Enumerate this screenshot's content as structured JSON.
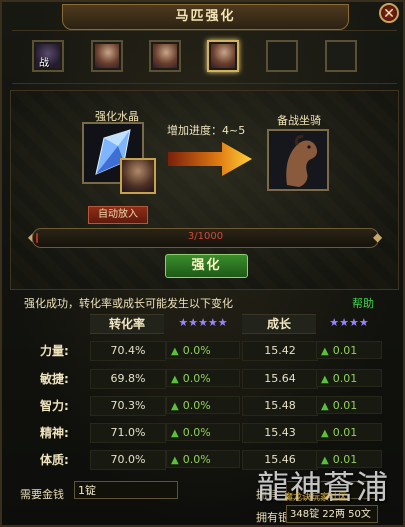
{
  "window": {
    "title": "马匹强化",
    "close_icon": "close-icon"
  },
  "slots": [
    {
      "tag": "战",
      "selected": false
    },
    {
      "tag": "",
      "selected": false
    },
    {
      "tag": "",
      "selected": false
    },
    {
      "tag": "",
      "selected": true
    },
    {
      "tag": "",
      "selected": false
    },
    {
      "tag": "",
      "selected": false
    }
  ],
  "enhance": {
    "crystal_label": "强化水晶",
    "auto_button": "自动放入",
    "progress_label": "增加进度：4~5",
    "target_label": "备战坐骑",
    "progress_text": "3/1000",
    "progress_fraction": 0.003,
    "strengthen_button": "强化"
  },
  "notice": "强化成功，转化率或成长可能发生以下变化",
  "help": "帮助",
  "table": {
    "headers": {
      "conversion": "转化率",
      "growth": "成长",
      "stars5": "★★★★★",
      "stars4": "★★★★"
    },
    "rows": [
      {
        "label": "力量:",
        "conv": "70.4%",
        "conv_up": "0.0%",
        "growth": "15.42",
        "growth_up": "0.01"
      },
      {
        "label": "敏捷:",
        "conv": "69.8%",
        "conv_up": "0.0%",
        "growth": "15.64",
        "growth_up": "0.01"
      },
      {
        "label": "智力:",
        "conv": "70.3%",
        "conv_up": "0.0%",
        "growth": "15.48",
        "growth_up": "0.01"
      },
      {
        "label": "精神:",
        "conv": "71.0%",
        "conv_up": "0.0%",
        "growth": "15.43",
        "growth_up": "0.01"
      },
      {
        "label": "体质:",
        "conv": "70.0%",
        "conv_up": "0.0%",
        "growth": "15.46",
        "growth_up": "0.01"
      }
    ]
  },
  "footer": {
    "cost_label": "需要金钱",
    "cost_value": "1锭",
    "own_label_1": "拥有",
    "own_value_1": "",
    "own_label_2": "拥有银子",
    "own_value_2": "348锭 22两 50文"
  },
  "watermark": {
    "text": "龍神蒼浦",
    "sub": "魔龙诀玩家社区"
  }
}
